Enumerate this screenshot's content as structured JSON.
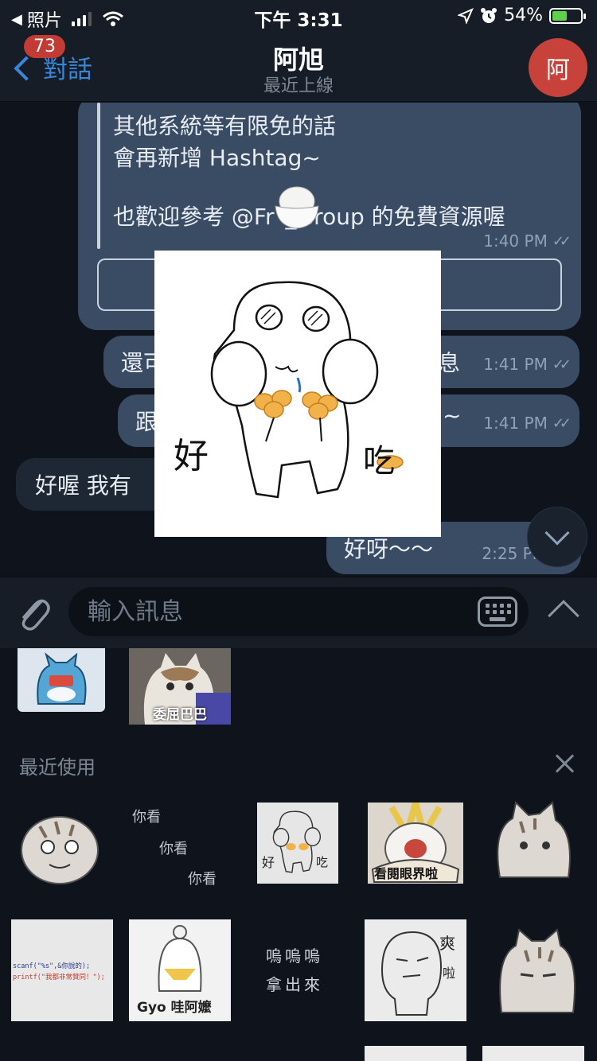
{
  "status_bar": {
    "back_app": "照片",
    "time": "下午 3:31",
    "battery_pct": "54%",
    "battery_level": 0.54
  },
  "header": {
    "back_label": "對話",
    "unread_badge": "73",
    "title": "阿旭",
    "subtitle": "最近上線",
    "avatar_initial": "阿"
  },
  "messages": {
    "big": {
      "lines": [
        "其他系統等有限免的話",
        "會再新增 Hashtag~",
        "也歡迎參考 @Fr _Group 的免費資源喔"
      ],
      "time": "1:40 PM"
    },
    "out1": {
      "text": "還可",
      "text_tail": "息",
      "time": "1:41 PM"
    },
    "out2": {
      "text": "跟",
      "text_tail": "~",
      "time": "1:41 PM"
    },
    "in1": {
      "text": "好喔 我有"
    },
    "out3": {
      "text": "好呀～～",
      "time": "2:25 PM"
    }
  },
  "sticker_preview": {
    "left_text": "好",
    "right_text": "吃"
  },
  "input": {
    "placeholder": "輸入訊息"
  },
  "sticker_panel": {
    "top_row_caption": "委屈巴巴",
    "section_title": "最近使用",
    "stickers": {
      "s_nikan_lines": [
        "你看",
        "你看",
        "你看"
      ],
      "s_small_hao": "好",
      "s_small_chi": "吃",
      "s_sign": "看閱眼界啦",
      "s_code_line1": "scanf(\"%s\",&你說的);",
      "s_code_line2": "printf(\"我都非常贊同！\");",
      "s_gyo": "Gyo 哇阿嬤",
      "s_wuwu1": "嗚嗚嗚",
      "s_wuwu2": "拿出來",
      "s_shuang": "爽",
      "s_la": "啦"
    }
  },
  "colors": {
    "accent": "#3a86d6",
    "badge": "#c23b34",
    "avatar": "#c6423a",
    "bubble_out": "#3a4b64",
    "bubble_in": "#1e2835",
    "background": "#0f141c"
  }
}
